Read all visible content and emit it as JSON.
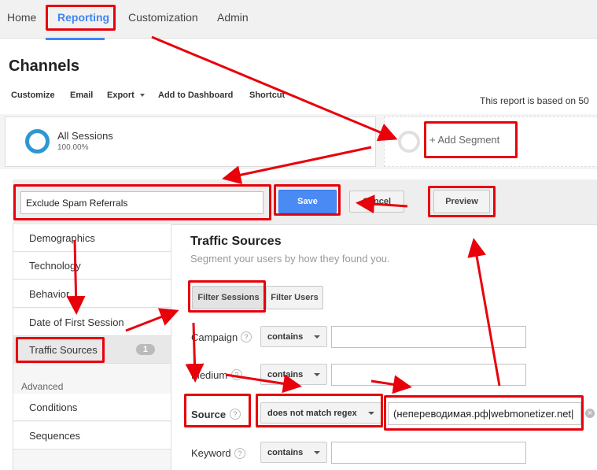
{
  "nav": {
    "tabs": [
      "Home",
      "Reporting",
      "Customization",
      "Admin"
    ],
    "active_tab": "Reporting"
  },
  "page": {
    "title": "Channels",
    "report_note": "This report is based on 50"
  },
  "toolbar": {
    "items": [
      "Customize",
      "Email",
      "Export",
      "Add to Dashboard",
      "Shortcut"
    ]
  },
  "segments": {
    "all_sessions": {
      "label": "All Sessions",
      "percent": "100.00%"
    },
    "add_segment": "+ Add Segment"
  },
  "builder": {
    "segment_name": "Exclude Spam Referrals",
    "save_label": "Save",
    "cancel_label": "Cancel",
    "preview_label": "Preview"
  },
  "sidebar": {
    "items": [
      "Demographics",
      "Technology",
      "Behavior",
      "Date of First Session",
      "Traffic Sources"
    ],
    "selected": "Traffic Sources",
    "traffic_sources_count": "1",
    "advanced_label": "Advanced",
    "advanced_items": [
      "Conditions",
      "Sequences"
    ]
  },
  "main": {
    "title": "Traffic Sources",
    "subtitle": "Segment your users by how they found you.",
    "filter_sessions": "Filter Sessions",
    "filter_users": "Filter Users",
    "rows": [
      {
        "label": "Campaign",
        "operator": "contains",
        "value": ""
      },
      {
        "label": "Medium",
        "operator": "contains",
        "value": ""
      },
      {
        "label": "Source",
        "operator": "does not match regex",
        "value": "(непереводимая.рф|webmonetizer.net|"
      },
      {
        "label": "Keyword",
        "operator": "contains",
        "value": ""
      }
    ]
  },
  "icons": {
    "help": "?",
    "clear": "×"
  },
  "colors": {
    "accent": "#4285f4",
    "annotation": "#e8000b",
    "save_button": "#4a8af4"
  }
}
